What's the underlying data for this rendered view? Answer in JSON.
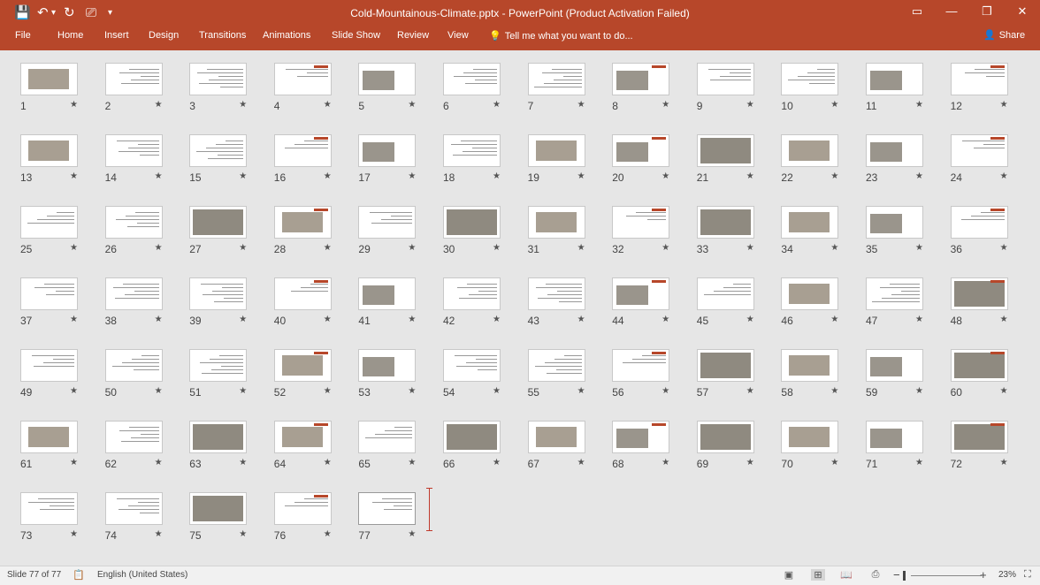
{
  "window": {
    "title": "Cold-Mountainous-Climate.pptx - PowerPoint (Product Activation Failed)",
    "quick_access": [
      {
        "name": "save-icon",
        "glyph": "💾"
      },
      {
        "name": "undo-icon",
        "glyph": "↶"
      },
      {
        "name": "undo-dropdown-icon",
        "glyph": "▾"
      },
      {
        "name": "redo-icon",
        "glyph": "↻"
      },
      {
        "name": "start-from-beginning-icon",
        "glyph": "⎚"
      },
      {
        "name": "customize-quick-access-icon",
        "glyph": "▾"
      }
    ],
    "controls": [
      {
        "name": "ribbon-display-options-icon",
        "glyph": "▭"
      },
      {
        "name": "minimize-icon",
        "glyph": "—"
      },
      {
        "name": "restore-icon",
        "glyph": "❐"
      },
      {
        "name": "close-icon",
        "glyph": "✕"
      }
    ]
  },
  "ribbon": {
    "tabs": [
      "File",
      "Home",
      "Insert",
      "Design",
      "Transitions",
      "Animations",
      "Slide Show",
      "Review",
      "View"
    ],
    "tell_me": "Tell me what you want to do...",
    "share": "Share"
  },
  "slides": {
    "count": 77,
    "star": "★",
    "numbers": [
      "1",
      "2",
      "3",
      "4",
      "5",
      "6",
      "7",
      "8",
      "9",
      "10",
      "11",
      "12",
      "13",
      "14",
      "15",
      "16",
      "17",
      "18",
      "19",
      "20",
      "21",
      "22",
      "23",
      "24",
      "25",
      "26",
      "27",
      "28",
      "29",
      "30",
      "31",
      "32",
      "33",
      "34",
      "35",
      "36",
      "37",
      "38",
      "39",
      "40",
      "41",
      "42",
      "43",
      "44",
      "45",
      "46",
      "47",
      "48",
      "49",
      "50",
      "51",
      "52",
      "53",
      "54",
      "55",
      "56",
      "57",
      "58",
      "59",
      "60",
      "61",
      "62",
      "63",
      "64",
      "65",
      "66",
      "67",
      "68",
      "69",
      "70",
      "71",
      "72",
      "73",
      "74",
      "75",
      "76",
      "77"
    ],
    "photo_slides": [
      1,
      5,
      8,
      11,
      13,
      17,
      19,
      20,
      21,
      22,
      23,
      27,
      28,
      30,
      31,
      33,
      34,
      35,
      41,
      44,
      46,
      48,
      52,
      53,
      57,
      58,
      59,
      60,
      61,
      63,
      64,
      66,
      67,
      68,
      69,
      70,
      71,
      72,
      75
    ],
    "selected": 77
  },
  "colors": {
    "accent": "#b7472a",
    "background": "#e6e6e6"
  },
  "status": {
    "slide_info": "Slide 77 of 77",
    "language": "English (United States)",
    "zoom": "23%",
    "zoom_minus": "−",
    "zoom_plus": "+",
    "views": [
      {
        "name": "normal-view-icon",
        "glyph": "▣"
      },
      {
        "name": "slide-sorter-view-icon",
        "glyph": "⊞"
      },
      {
        "name": "reading-view-icon",
        "glyph": "📖"
      },
      {
        "name": "slide-show-view-icon",
        "glyph": "⎙"
      }
    ],
    "fit_icon": "⛶"
  }
}
